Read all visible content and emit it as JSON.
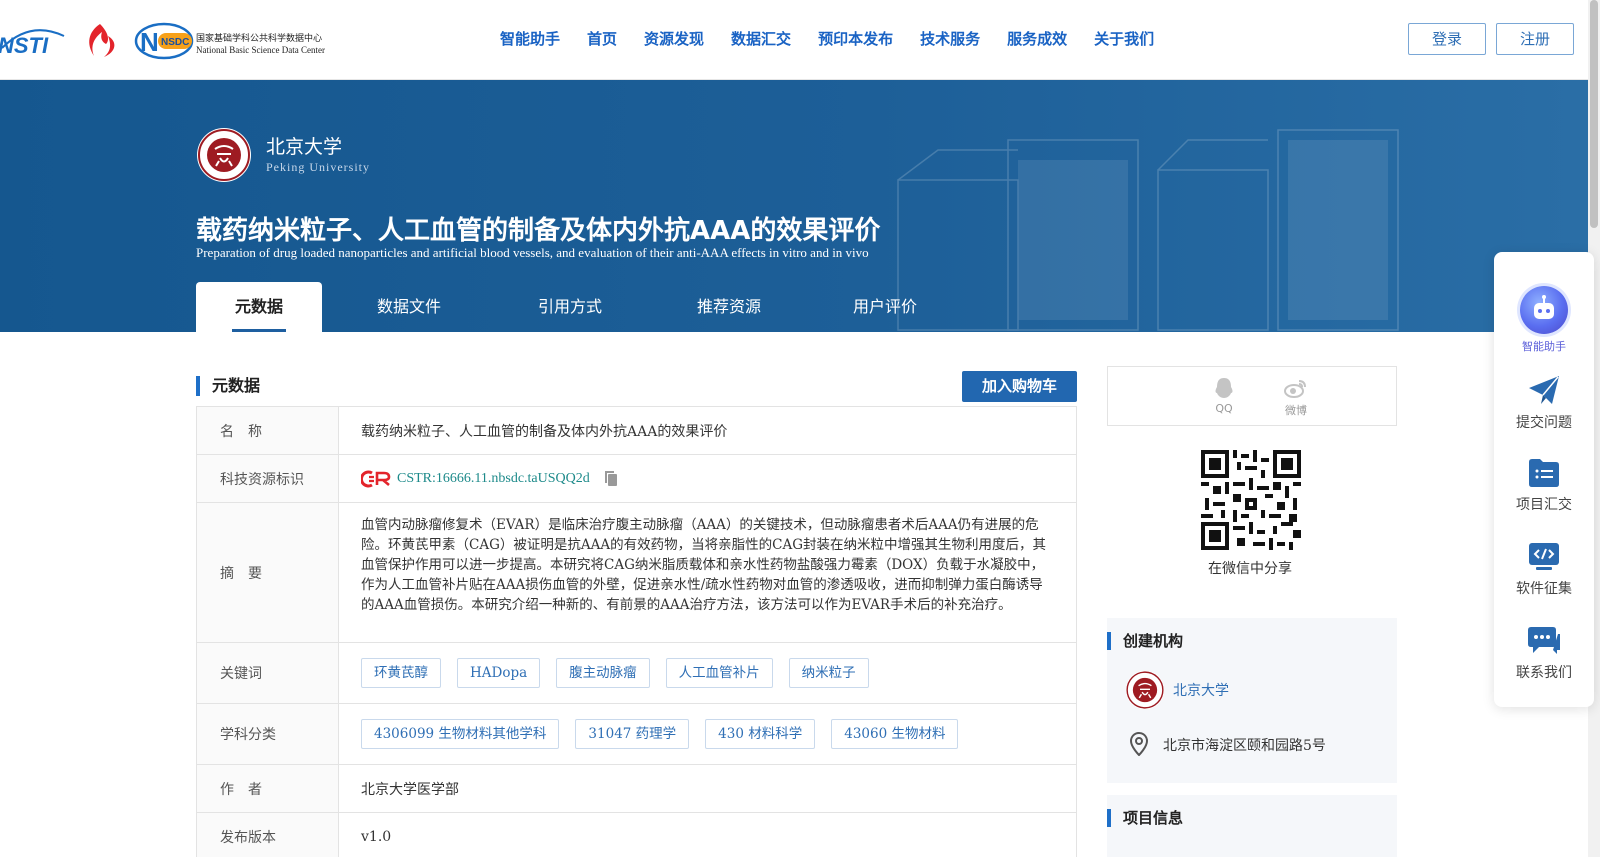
{
  "header": {
    "logo_nsti_text": "NSTI",
    "logo_nsdc_cn": "国家基础学科公共科学数据中心",
    "logo_nsdc_en": "National Basic Science Data Center",
    "logo_nsdc_badge": "NSDC",
    "nav": [
      "智能助手",
      "首页",
      "资源发现",
      "数据汇交",
      "预印本发布",
      "技术服务",
      "服务成效",
      "关于我们"
    ],
    "login": "登录",
    "register": "注册"
  },
  "hero": {
    "org_name": "北京大学",
    "org_name_en": "Peking University",
    "title_cn": "载药纳米粒子、人工血管的制备及体内外抗AAA的效果评价",
    "title_en": "Preparation of drug loaded nanoparticles and artificial blood vessels, and evaluation of their anti-AAA effects in vitro and in vivo",
    "tabs": [
      "元数据",
      "数据文件",
      "引用方式",
      "推荐资源",
      "用户评价"
    ],
    "active_tab": 0
  },
  "metadata": {
    "section_title": "元数据",
    "cart_button": "加入购物车",
    "rows": {
      "name": {
        "label": "名　称",
        "value": "载药纳米粒子、人工血管的制备及体内外抗AAA的效果评价"
      },
      "identifier": {
        "label": "科技资源标识",
        "value": "CSTR:16666.11.nbsdc.taUSQQ2d"
      },
      "abstract": {
        "label": "摘　要",
        "value": "血管内动脉瘤修复术（EVAR）是临床治疗腹主动脉瘤（AAA）的关键技术，但动脉瘤患者术后AAA仍有进展的危险。环黄芪甲素（CAG）被证明是抗AAA的有效药物，当将亲脂性的CAG封装在纳米粒中增强其生物利用度后，其血管保护作用可以进一步提高。本研究将CAG纳米脂质载体和亲水性药物盐酸强力霉素（DOX）负载于水凝胶中，作为人工血管补片贴在AAA损伤血管的外壁，促进亲水性/疏水性药物对血管的渗透吸收，进而抑制弹力蛋白酶诱导的AAA血管损伤。本研究介绍一种新的、有前景的AAA治疗方法，该方法可以作为EVAR手术后的补充治疗。"
      },
      "keywords": {
        "label": "关键词",
        "values": [
          "环黄芪醇",
          "HADopa",
          "腹主动脉瘤",
          "人工血管补片",
          "纳米粒子"
        ]
      },
      "subjects": {
        "label": "学科分类",
        "values": [
          "4306099 生物材料其他学科",
          "31047 药理学",
          "430 材料科学",
          "43060 生物材料"
        ]
      },
      "authors": {
        "label": "作　者",
        "value": "北京大学医学部"
      },
      "version": {
        "label": "发布版本",
        "value": "v1.0"
      }
    }
  },
  "share": {
    "qq": "QQ",
    "weibo": "微博",
    "wechat_label": "在微信中分享"
  },
  "creator_card": {
    "title": "创建机构",
    "org": "北京大学",
    "address": "北京市海淀区颐和园路5号"
  },
  "project_card": {
    "title": "项目信息"
  },
  "side_toolbar": {
    "items": [
      "智能助手",
      "提交问题",
      "项目汇交",
      "软件征集",
      "联系我们"
    ]
  },
  "colors": {
    "brand_blue": "#1e5fa0",
    "nav_blue": "#1a63c4",
    "cart_button": "#2267b0",
    "cstr_teal": "#1d8a8a",
    "pku_red": "#9e1b22"
  },
  "icons": [
    "nsti-logo",
    "red-flame-logo",
    "nsdc-logo",
    "pku-seal",
    "copy-icon",
    "cstr-logo",
    "qq-icon",
    "weibo-icon",
    "qr-code",
    "location-pin-icon",
    "robot-icon",
    "paper-plane-icon",
    "folder-list-icon",
    "code-icon",
    "chat-icon"
  ]
}
